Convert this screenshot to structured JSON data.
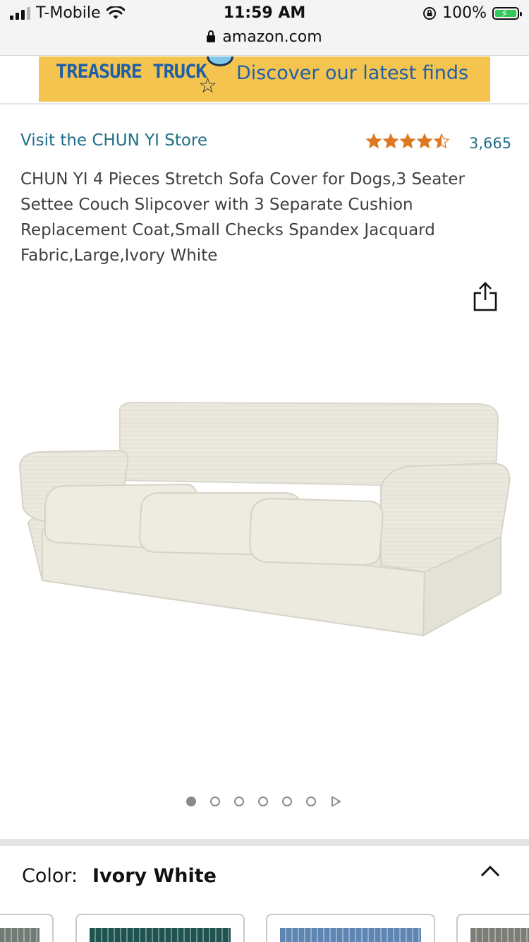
{
  "status_bar": {
    "carrier": "T-Mobile",
    "time": "11:59 AM",
    "battery": "100%",
    "url": "amazon.com"
  },
  "banner": {
    "title": "TREASURE TRUCK",
    "tagline": "Discover our latest finds"
  },
  "product": {
    "store_link": "Visit the CHUN YI Store",
    "rating_stars": "★★★★☆",
    "rating_count": "3,665",
    "title": "CHUN YI 4 Pieces Stretch Sofa Cover for Dogs,3 Seater Settee Couch Slipcover with 3 Separate Cushion Replacement Coat,Small Checks Spandex Jacquard Fabric,Large,Ivory White"
  },
  "gallery": {
    "image_count": 6,
    "active_index": 0
  },
  "color": {
    "label": "Color:",
    "value": "Ivory White",
    "swatch_colors": [
      "#6f7b74",
      "#1f5350",
      "#5f86b3",
      "#7d7d78"
    ]
  }
}
